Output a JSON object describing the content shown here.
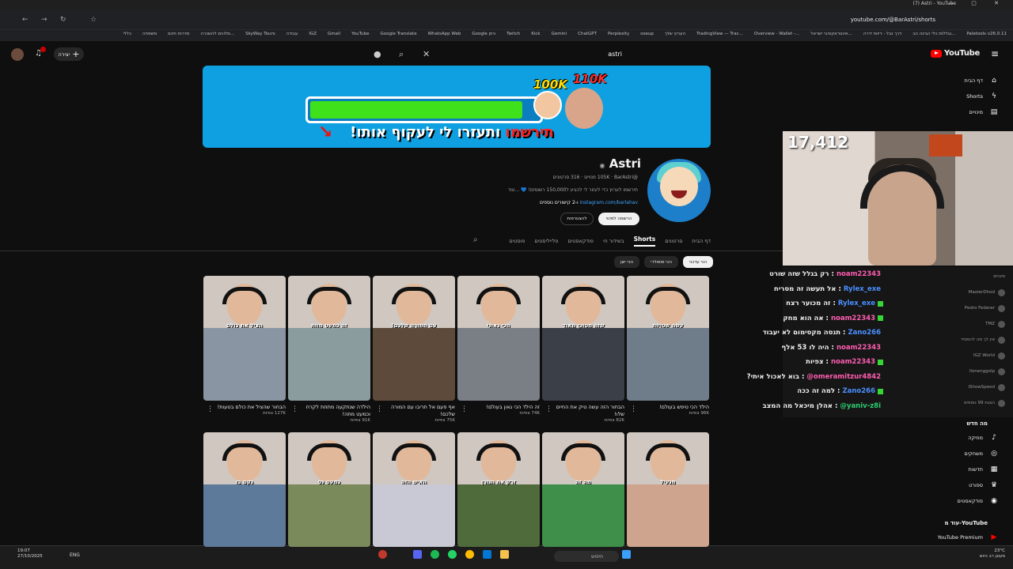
{
  "browser": {
    "tab_title": "(7) Astri - YouTube",
    "url": "youtube.com/@BarAstri/shorts",
    "window_controls": "— ▢ ✕",
    "bookmarks": [
      "Paletools v26.0.11",
      "נגללות כלי הבינה הב...",
      "דרך נבל - דיווח דירה",
      "אינטראקטיבי ישראל...",
      "Overview - Wallet -...",
      "TradingView — Trac...",
      "הערוץ שלך",
      "oseup",
      "Perplexity",
      "ChatGPT",
      "Gemini",
      "Kick",
      "Twitch",
      "Google ניתן",
      "WhatsApp Web",
      "Google Translate",
      "YouTube",
      "Gmail",
      "IGZ",
      "עבודה",
      "SkyWay Tours",
      "מלונים להשכרה...",
      "סדרות חינם",
      "משפחה",
      "כללי"
    ]
  },
  "youtube": {
    "logo_text": "YouTube",
    "search_value": "astri",
    "create_label": "יצירה",
    "notifications_count": "",
    "nav": [
      {
        "label": "דף הבית",
        "icon": "home-icon",
        "glyph": "⌂"
      },
      {
        "label": "Shorts",
        "icon": "shorts-icon",
        "glyph": "ϟ"
      },
      {
        "label": "מינויים",
        "icon": "subscriptions-icon",
        "glyph": "▤"
      }
    ],
    "nav_more_header": "מה חדש",
    "nav_more": [
      {
        "label": "מוזיקה",
        "icon": "music-icon",
        "glyph": "♪"
      },
      {
        "label": "משחקים",
        "icon": "gaming-icon",
        "glyph": "◎"
      },
      {
        "label": "חדשות",
        "icon": "news-icon",
        "glyph": "▦"
      },
      {
        "label": "ספורט",
        "icon": "trophy-icon",
        "glyph": "♛"
      },
      {
        "label": "פודקאסטים",
        "icon": "podcast-icon",
        "glyph": "◉"
      }
    ],
    "more_from_header": "עוד מ-YouTube",
    "premium_label": "YouTube Premium"
  },
  "banner": {
    "label_100k": "100K",
    "label_110k": "110K",
    "text_red": "תירשמו",
    "text_white": "ותעזרו לי לעקוף אותו!",
    "progress_fraction": 0.91
  },
  "channel": {
    "name": "Astri",
    "verified": "◉",
    "handle_line": "@BarAstri · ‏105K מנויים · 316 סרטונים",
    "description": "תירשמו לערוץ כדי לעזור לי להגיע ל150,000 רשומים! 💙 ...עוד",
    "link_text": "instagram.com/barlahav",
    "link_suffix": " ו-2 קישורים נוספים",
    "subscribe_label": "הרשמה למינוי",
    "join_label": "להצטרפות",
    "tabs": [
      "דף הבית",
      "סרטונים",
      "Shorts",
      "בשידור חי",
      "פודקאסטים",
      "פלייליסטים",
      "פוסטים"
    ],
    "active_tab": "Shorts",
    "chips": [
      "הכי עדכני",
      "הכי פופולרי",
      "הכי ישן"
    ]
  },
  "shorts_row1": [
    {
      "caption": "עשה שטויות",
      "title": "הילד הכי טיפש בעולם!",
      "views": "96K צפיות",
      "bg": "#6f7c8a"
    },
    {
      "caption": "שזה מסוכן מאוד",
      "title": "הבחור הזה עשה טיק את החיים שלו!",
      "views": "82K צפיות",
      "bg": "#3a3f48"
    },
    {
      "caption": "הכי גאוני",
      "title": "זה הילד הכי גאון בעולם!",
      "views": "74K צפיות",
      "bg": "#7a7f86"
    },
    {
      "caption": "עם המורה שלכם!",
      "title": "אף פעם אל תריבו עם המורה שלכם!",
      "views": "75K צפיות",
      "bg": "#5d4a3a"
    },
    {
      "caption": "זה כמעט מוות",
      "title": "הילדה שנתקעה מתחת לקרח וכמעט מתה!",
      "views": "91K צפיות",
      "bg": "#8a9c9e"
    },
    {
      "caption": "הציל את כולם",
      "title": "הבחור שהציל את כולם בטעות!",
      "views": "127K צפיות",
      "bg": "#8995a2"
    }
  ],
  "shorts_row2": [
    {
      "caption": "מגעיל",
      "bg": "#cfa48f"
    },
    {
      "caption": "מה זה",
      "bg": "#3f8f4a"
    },
    {
      "caption": "זרק את הגורן",
      "bg": "#4f6b3c"
    },
    {
      "caption": "האיש הזה",
      "bg": "#c9c9d6"
    },
    {
      "caption": "כמעט נס",
      "bg": "#7a8a5a"
    },
    {
      "caption": "נקם בו",
      "bg": "#5e7a9a"
    }
  ],
  "stream": {
    "viewer_count": "17,412",
    "chat": [
      {
        "platform": "kick",
        "user": "noam22343",
        "message": "רק בגלל שזה שורט",
        "color": "#ff5db1"
      },
      {
        "platform": "kick",
        "user": "Rylex_exe",
        "message": "אל תעשה זה מסריח",
        "color": "#4a90ff"
      },
      {
        "platform": "kick",
        "user": "Rylex_exe",
        "message": "זה מכוער רצח",
        "color": "#4a90ff"
      },
      {
        "platform": "kick",
        "user": "noam22343",
        "message": "אה הוא מחק",
        "color": "#ff5db1"
      },
      {
        "platform": "kick",
        "user": "Zano266",
        "message": "תנסה מקסימום לא יעבוד",
        "color": "#4a90ff"
      },
      {
        "platform": "kick",
        "user": "noam22343",
        "message": "היה לו 53 אלף",
        "color": "#ff5db1"
      },
      {
        "platform": "kick",
        "user": "noam22343",
        "message": "צפיות",
        "color": "#ff5db1"
      },
      {
        "platform": "youtube",
        "user": "@omeramitzur4842",
        "message": "בוא לאכול איתי?",
        "color": "#ff5db1"
      },
      {
        "platform": "kick",
        "user": "Zano266",
        "message": "למה זה ככה",
        "color": "#4a90ff"
      },
      {
        "platform": "youtube",
        "user": "@yaniv-z8i",
        "message": "אהלן מיכאל מה המצב",
        "color": "#2ecc71"
      }
    ],
    "side_header": "מינויים",
    "side_items": [
      "MasterDhod",
      "Pedro Federer",
      "TMZ",
      "אין לך מה להפסיד",
      "IGZ World",
      "llonenggolp",
      "iShowSpeed",
      "הצגת 99 נוספים"
    ]
  },
  "taskbar": {
    "time": "19:07",
    "date": "27/10/2025",
    "lang": "ENG",
    "search_placeholder": "חיפוש",
    "weather_temp": "23°C",
    "weather_desc": "מעונן רב היום"
  }
}
